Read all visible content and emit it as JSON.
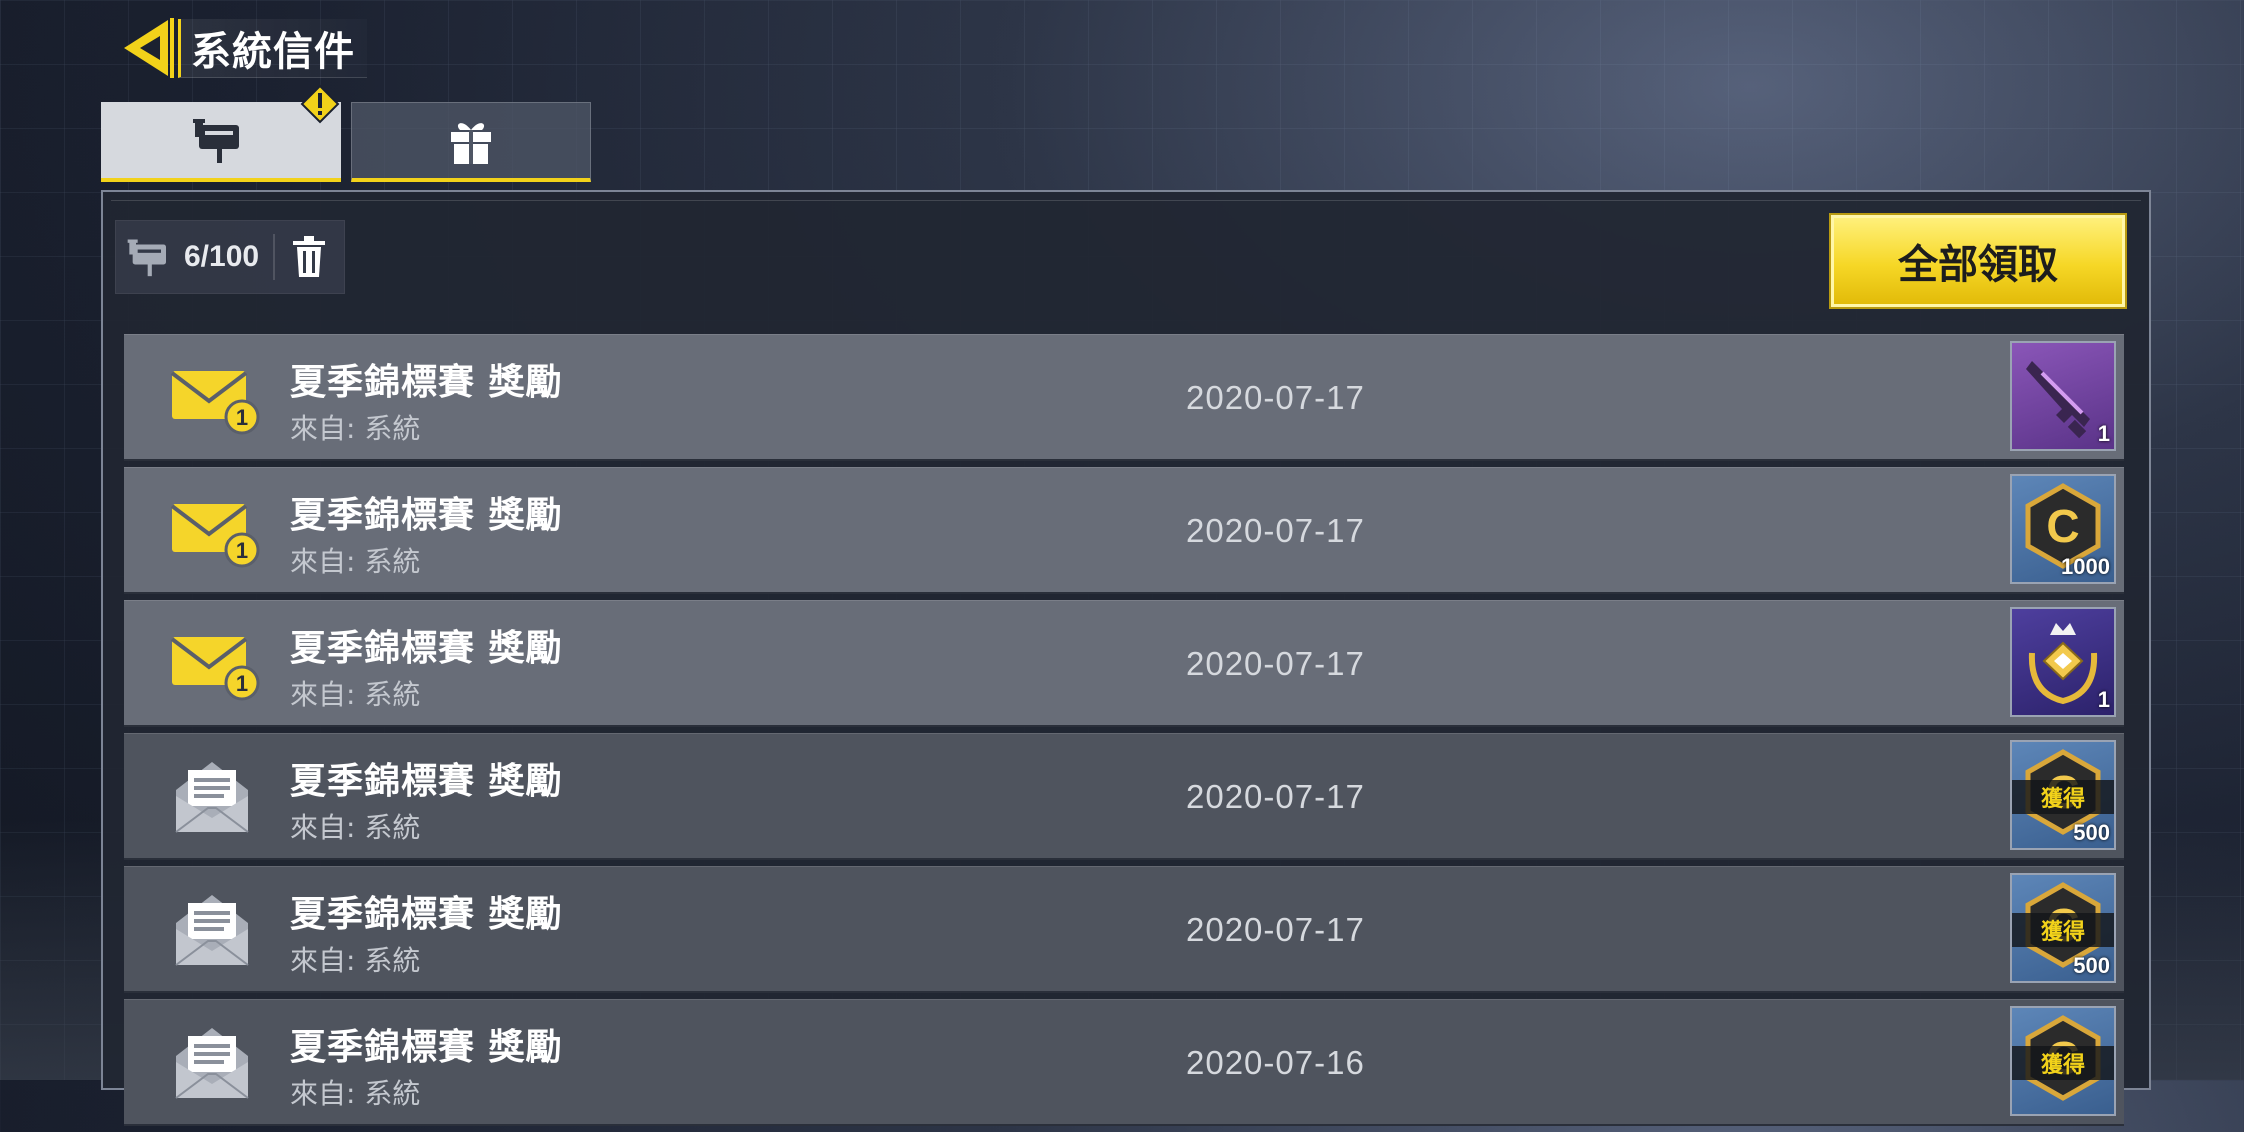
{
  "header": {
    "title": "系統信件"
  },
  "tabs": [
    {
      "name": "mail",
      "icon": "mailbox-icon",
      "active": true,
      "alert": true
    },
    {
      "name": "gift",
      "icon": "gift-icon",
      "active": false
    }
  ],
  "toolbar": {
    "mail_count": "6/100",
    "claim_all_label": "全部領取"
  },
  "mails": [
    {
      "title": "夏季錦標賽 獎勵",
      "sender": "來自: 系統",
      "date": "2020-07-17",
      "read": false,
      "unread_count": "1",
      "reward": {
        "icon": "rifle-icon",
        "qty": "1",
        "claimed": false
      }
    },
    {
      "title": "夏季錦標賽 獎勵",
      "sender": "來自: 系統",
      "date": "2020-07-17",
      "read": false,
      "unread_count": "1",
      "reward": {
        "icon": "credit-icon",
        "qty": "1000",
        "claimed": false
      }
    },
    {
      "title": "夏季錦標賽 獎勵",
      "sender": "來自: 系統",
      "date": "2020-07-17",
      "read": false,
      "unread_count": "1",
      "reward": {
        "icon": "crown-badge-icon",
        "qty": "1",
        "claimed": false
      }
    },
    {
      "title": "夏季錦標賽 獎勵",
      "sender": "來自: 系統",
      "date": "2020-07-17",
      "read": true,
      "reward": {
        "icon": "credit-icon",
        "qty": "500",
        "claimed": true,
        "claimed_label": "獲得"
      }
    },
    {
      "title": "夏季錦標賽 獎勵",
      "sender": "來自: 系統",
      "date": "2020-07-17",
      "read": true,
      "reward": {
        "icon": "credit-icon",
        "qty": "500",
        "claimed": true,
        "claimed_label": "獲得"
      }
    },
    {
      "title": "夏季錦標賽 獎勵",
      "sender": "來自: 系統",
      "date": "2020-07-16",
      "read": true,
      "reward": {
        "icon": "credit-icon",
        "claimed": true,
        "claimed_label": "獲得"
      }
    }
  ],
  "colors": {
    "accent": "#f2d21a",
    "row_unread": "#686d78",
    "row_read": "#4f545e",
    "panel": "#212632"
  }
}
